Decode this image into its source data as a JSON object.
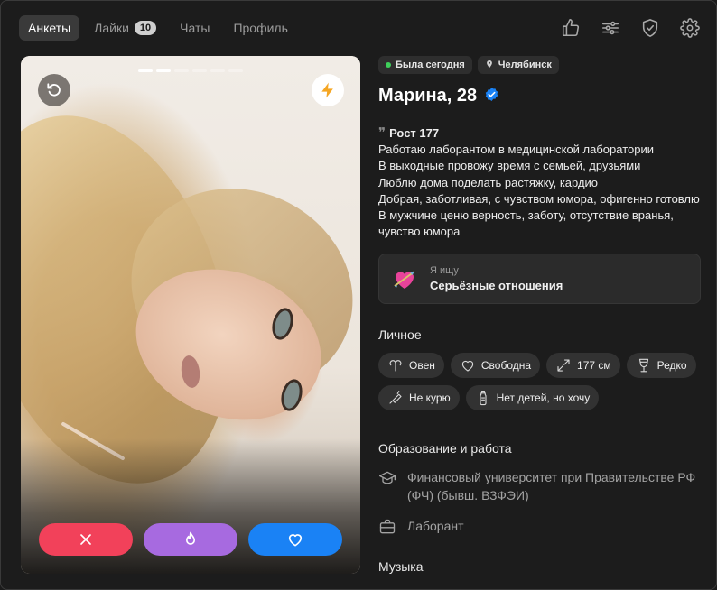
{
  "nav": {
    "tabs": [
      {
        "label": "Анкеты",
        "active": true
      },
      {
        "label": "Лайки",
        "badge": "10"
      },
      {
        "label": "Чаты"
      },
      {
        "label": "Профиль"
      }
    ],
    "icons": [
      "thumbs-up-icon",
      "sliders-icon",
      "shield-check-icon",
      "gear-icon"
    ]
  },
  "card": {
    "photo_count": 6,
    "active_photo": 2,
    "icons": {
      "undo": "undo-icon",
      "boost": "lightning-icon"
    },
    "actions": [
      "close-icon",
      "flame-icon",
      "heart-icon"
    ],
    "colors": {
      "dislike": "#f2415a",
      "superlike": "#a76ae0",
      "like": "#1a82f5"
    }
  },
  "profile": {
    "status": "Была сегодня",
    "city": "Челябинск",
    "name_age": "Марина, 28",
    "bio": {
      "first_line": "Рост 177",
      "lines": [
        "Работаю лаборантом в медицинской лаборатории",
        "В выходные провожу время с семьей, друзьями",
        "Люблю дома поделать растяжку, кардио",
        "Добрая, заботливая, с чувством юмора, офигенно готовлю",
        "В мужчине ценю верность, заботу, отсутствие вранья,",
        "чувство юмора"
      ]
    },
    "seeking": {
      "label": "Я ищу",
      "value": "Серьёзные отношения"
    },
    "personal": {
      "title": "Личное",
      "pills": [
        {
          "icon": "aries-icon",
          "label": "Овен"
        },
        {
          "icon": "heart-outline-icon",
          "label": "Свободна"
        },
        {
          "icon": "height-icon",
          "label": "177 см"
        },
        {
          "icon": "wine-glass-icon",
          "label": "Редко"
        },
        {
          "icon": "no-smoking-icon",
          "label": "Не курю"
        },
        {
          "icon": "baby-bottle-icon",
          "label": "Нет детей, но хочу"
        }
      ]
    },
    "education": {
      "title": "Образование и работа",
      "university": "Финансовый университет при Правительстве РФ (ФЧ) (бывш. ВЗФЭИ)",
      "job": "Лаборант"
    },
    "music_title": "Музыка"
  }
}
